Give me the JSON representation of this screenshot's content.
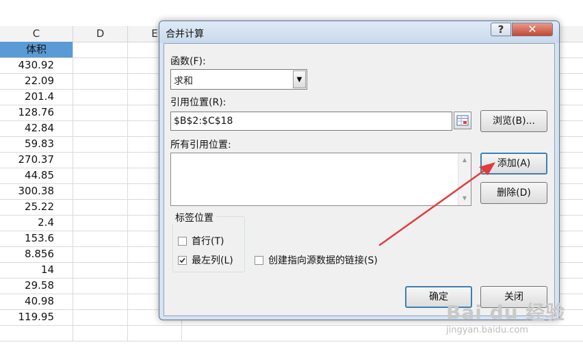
{
  "spreadsheet": {
    "columns": [
      "C",
      "D",
      "E"
    ],
    "header_cell": "体积",
    "values": [
      "430.92",
      "22.09",
      "201.4",
      "128.76",
      "42.84",
      "59.83",
      "270.37",
      "44.85",
      "300.38",
      "25.22",
      "2.4",
      "153.6",
      "8.856",
      "14",
      "29.58",
      "40.98",
      "119.95"
    ]
  },
  "dialog": {
    "title": "合并计算",
    "help": "?",
    "close": "✕",
    "function_label": "函数(F):",
    "function_value": "求和",
    "reference_label": "引用位置(R):",
    "reference_value": "$B$2:$C$18",
    "browse_button": "浏览(B)...",
    "all_refs_label": "所有引用位置:",
    "add_button": "添加(A)",
    "delete_button": "删除(D)",
    "label_position": "标签位置",
    "top_row": "首行(T)",
    "left_column": "最左列(L)",
    "create_links": "创建指向源数据的链接(S)",
    "ok_button": "确定",
    "close_button": "关闭"
  },
  "checks": {
    "top_row": false,
    "left_column": true,
    "create_links": false
  },
  "watermark": {
    "main": "Bai du 经验",
    "sub": "jingyan.baidu.com"
  },
  "colors": {
    "header_fill": "#5b9bd5",
    "arrow": "#e23b3b",
    "default_border": "#3c7fb1"
  }
}
